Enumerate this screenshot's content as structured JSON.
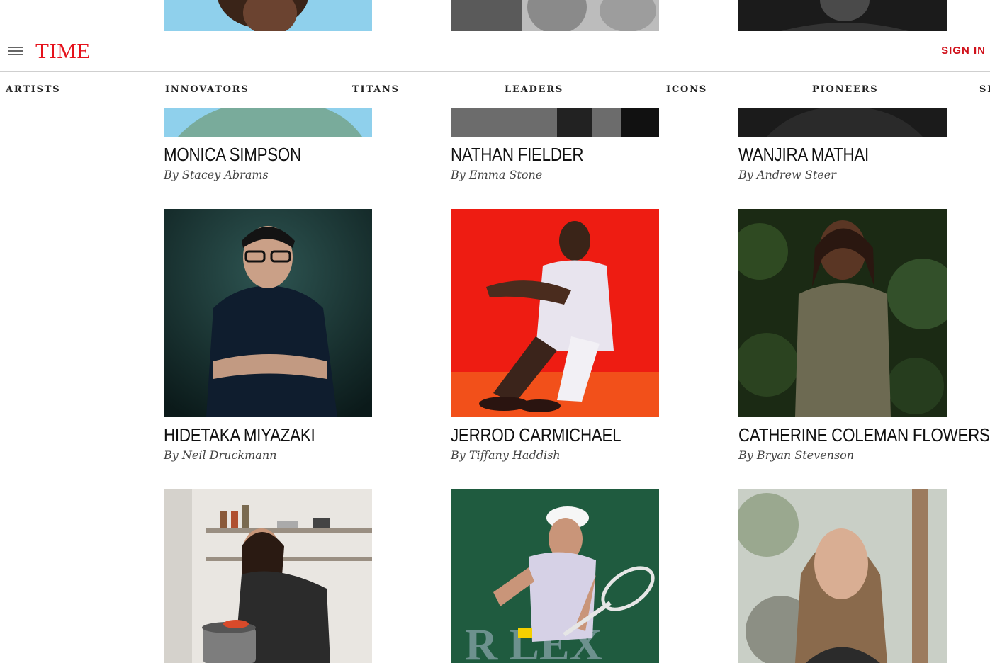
{
  "header": {
    "logo": "TIME",
    "sign_in": "SIGN IN"
  },
  "nav": {
    "items": [
      {
        "label": "ARTISTS"
      },
      {
        "label": "INNOVATORS"
      },
      {
        "label": "TITANS"
      },
      {
        "label": "LEADERS"
      },
      {
        "label": "ICONS"
      },
      {
        "label": "PIONEERS"
      },
      {
        "label": "SP"
      }
    ]
  },
  "people": [
    {
      "name": "MONICA SIMPSON",
      "byline": "By Stacey Abrams"
    },
    {
      "name": "NATHAN FIELDER",
      "byline": "By Emma Stone"
    },
    {
      "name": "WANJIRA MATHAI",
      "byline": "By Andrew Steer"
    },
    {
      "name": "HIDETAKA MIYAZAKI",
      "byline": "By Neil Druckmann"
    },
    {
      "name": "JERROD CARMICHAEL",
      "byline": "By Tiffany Haddish"
    },
    {
      "name": "CATHERINE COLEMAN FLOWERS",
      "byline": "By Bryan Stevenson"
    }
  ],
  "colors": {
    "brand_red": "#e5121c",
    "sign_in_red": "#d0111b"
  },
  "icons": [
    "menu-icon"
  ]
}
